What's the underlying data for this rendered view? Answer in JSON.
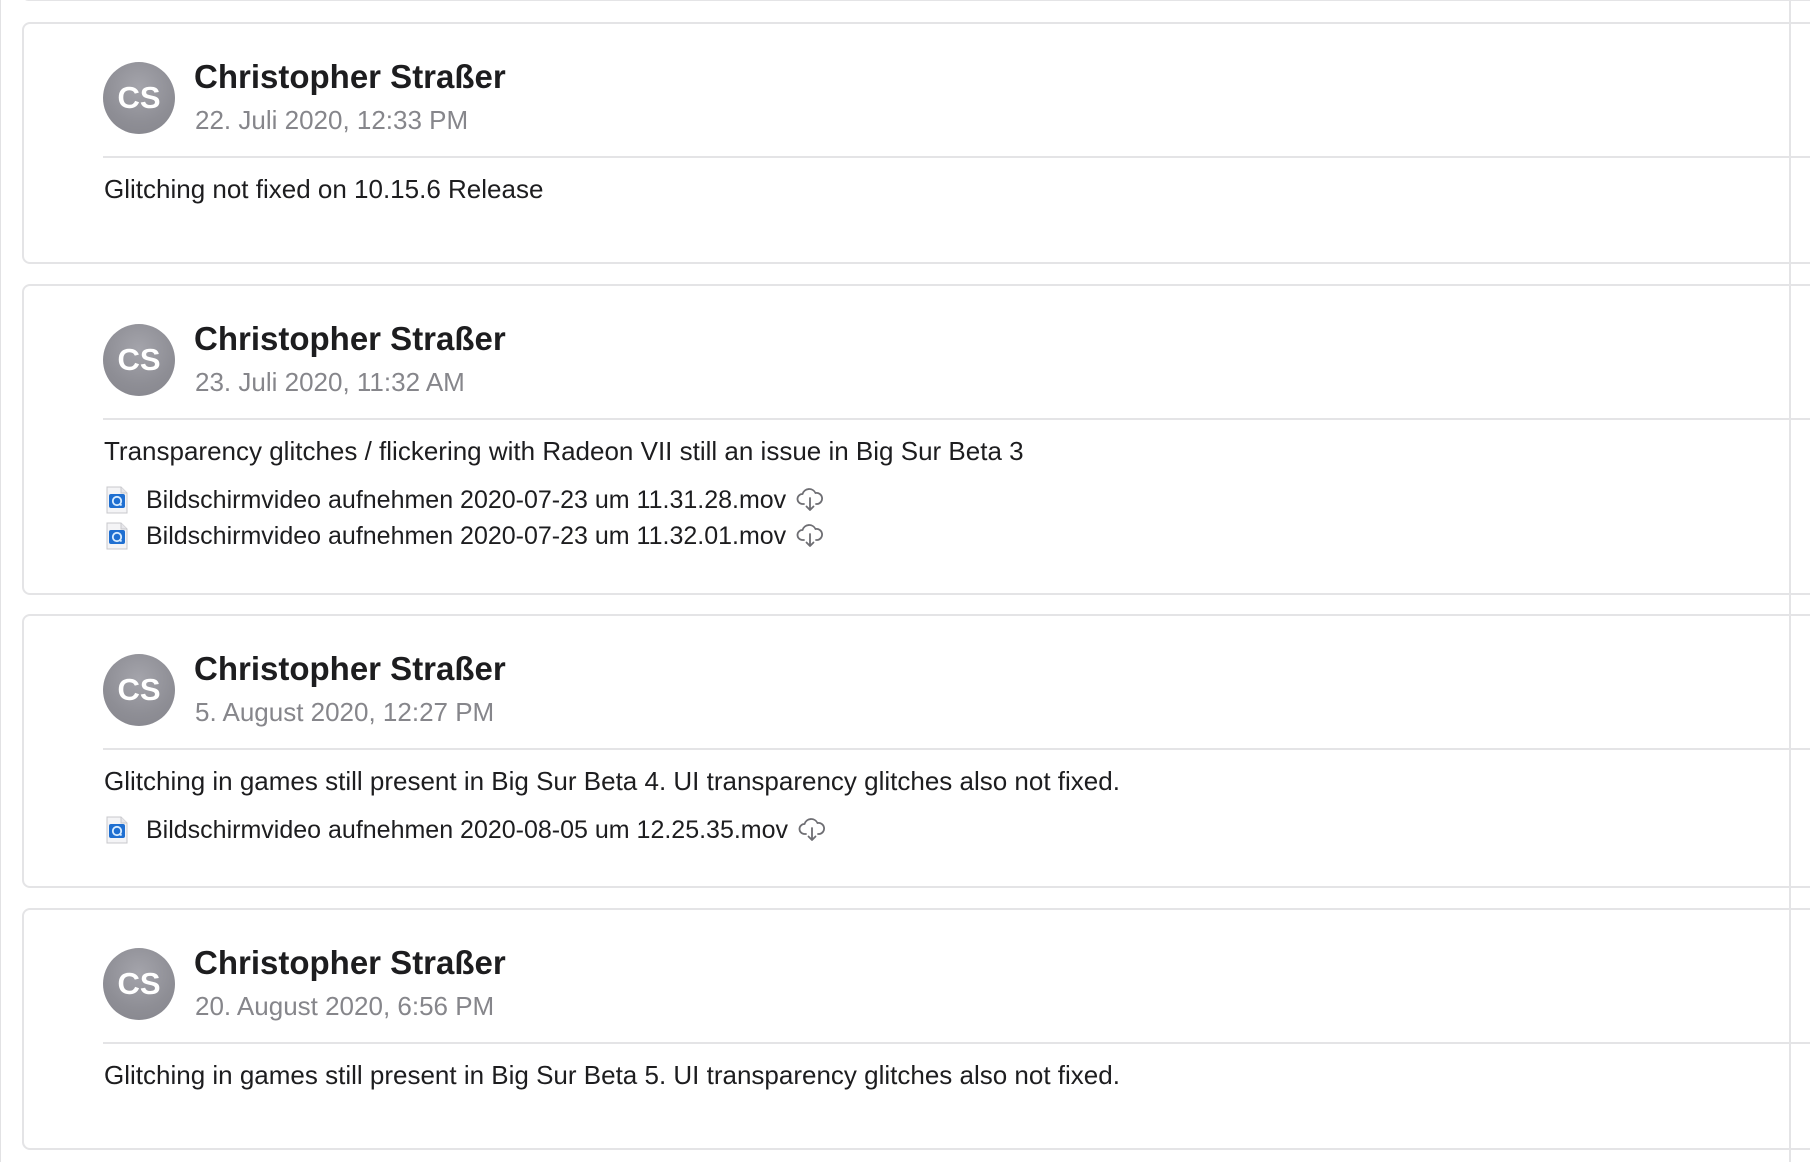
{
  "comments": [
    {
      "avatar_initials": "CS",
      "author": "Christopher Straßer",
      "timestamp": "22. Juli 2020, 12:33 PM",
      "message": "Glitching not fixed on 10.15.6 Release",
      "attachments": []
    },
    {
      "avatar_initials": "CS",
      "author": "Christopher Straßer",
      "timestamp": "23. Juli 2020, 11:32 AM",
      "message": "Transparency glitches / flickering with Radeon VII still an issue in Big Sur Beta 3",
      "attachments": [
        {
          "name": "Bildschirmvideo aufnehmen 2020-07-23 um 11.31.28.mov",
          "icon": "quicktime-file-icon",
          "action_icon": "cloud-download-icon"
        },
        {
          "name": "Bildschirmvideo aufnehmen 2020-07-23 um 11.32.01.mov",
          "icon": "quicktime-file-icon",
          "action_icon": "cloud-download-icon"
        }
      ]
    },
    {
      "avatar_initials": "CS",
      "author": "Christopher Straßer",
      "timestamp": "5. August 2020, 12:27 PM",
      "message": "Glitching in games still present in Big Sur Beta 4. UI transparency glitches also not fixed.",
      "attachments": [
        {
          "name": "Bildschirmvideo aufnehmen 2020-08-05 um 12.25.35.mov",
          "icon": "quicktime-file-icon",
          "action_icon": "cloud-download-icon"
        }
      ]
    },
    {
      "avatar_initials": "CS",
      "author": "Christopher Straßer",
      "timestamp": "20. August 2020, 6:56 PM",
      "message": "Glitching in games still present in Big Sur Beta 5. UI transparency glitches also not fixed.",
      "attachments": []
    }
  ],
  "colors": {
    "avatar_bg": "#8e8e95",
    "timestamp_text": "#86868b",
    "border": "#e4e4e6",
    "body_text": "#1d1d1f"
  }
}
